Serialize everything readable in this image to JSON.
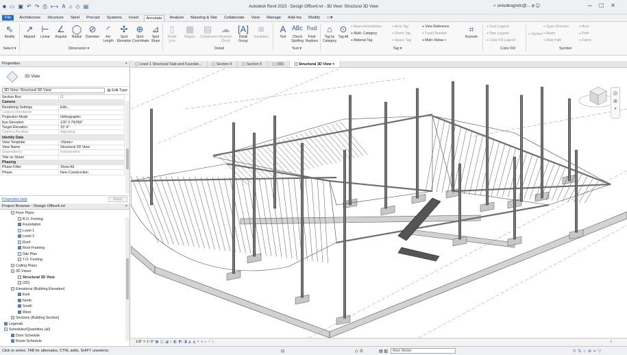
{
  "window": {
    "title": "Autodesk Revit 2023 - Design Office4.rvt - 3D View: Structural 3D View",
    "user": "unisdesgndc@..."
  },
  "ribbon_tabs": [
    "File",
    "Architecture",
    "Structure",
    "Steel",
    "Precast",
    "Systems",
    "Insert",
    "Annotate",
    "Analyze",
    "Massing & Site",
    "Collaborate",
    "View",
    "Manage",
    "Add-Ins",
    "Modify"
  ],
  "ribbon": {
    "modify": "Modify",
    "select": "Select ▾",
    "dimension_group": "Dimension ▾",
    "detail_group": "Detail",
    "text_group": "Text ▾",
    "tag_group": "Tag ▾",
    "color_fill_group": "Color Fill",
    "symbol_group": "Symbol",
    "dim_tools": [
      "Aligned",
      "Linear",
      "Angular",
      "Radial",
      "Diameter",
      "Arc Length",
      "Spot Elevation",
      "Spot Coordinate",
      "Spot Slope"
    ],
    "detail_tools": [
      "Detail Line",
      "Region",
      "Component",
      "Revision Cloud",
      "Detail Group",
      "Insulation"
    ],
    "text_tools": [
      "Text",
      "Check Spelling",
      "Find/ Replace"
    ],
    "tag_tools": [
      "Tag by Category",
      "Tag All"
    ],
    "tag_small": [
      "Beam Annotations",
      "Multi- Category",
      "Material Tag",
      "Area Tag",
      "Room Tag",
      "Space Tag",
      "View Reference",
      "Tread Number",
      "Multi- Rebar ▾"
    ],
    "keynote": "Keynote",
    "fill_small": [
      "Duct Legend",
      "Pipe Legend",
      "Color Fill Legend"
    ],
    "symbol_small": [
      "Symbol",
      "Span Direction",
      "Beam",
      "Stair Path",
      "Area",
      "Path",
      "Fabric"
    ]
  },
  "properties": {
    "header": "Properties",
    "type_name": "3D View",
    "selector": "3D View: Structural 3D View",
    "edit_type": "Edit Type",
    "rows": [
      {
        "k": "Section Box",
        "v": "☐",
        "cat": false,
        "dim": false
      },
      {
        "k": "Camera",
        "v": "",
        "cat": true,
        "dim": false
      },
      {
        "k": "Rendering Settings",
        "v": "Edit...",
        "cat": false,
        "dim": false
      },
      {
        "k": "Locked Orientation",
        "v": "",
        "cat": false,
        "dim": true
      },
      {
        "k": "Projection Mode",
        "v": "Orthographic",
        "cat": false,
        "dim": false
      },
      {
        "k": "Eye Elevation",
        "v": "130' 3 79/256\"",
        "cat": false,
        "dim": false
      },
      {
        "k": "Target Elevation",
        "v": "15' 4\"",
        "cat": false,
        "dim": false
      },
      {
        "k": "Camera Position",
        "v": "Adjusting",
        "cat": false,
        "dim": true
      },
      {
        "k": "Identity Data",
        "v": "",
        "cat": true,
        "dim": false
      },
      {
        "k": "View Template",
        "v": "<None>",
        "cat": false,
        "dim": false
      },
      {
        "k": "View Name",
        "v": "Structural 3D View",
        "cat": false,
        "dim": false
      },
      {
        "k": "Dependency",
        "v": "Independent",
        "cat": false,
        "dim": true
      },
      {
        "k": "Title on Sheet",
        "v": "",
        "cat": false,
        "dim": false
      },
      {
        "k": "Phasing",
        "v": "",
        "cat": true,
        "dim": false
      },
      {
        "k": "Phase Filter",
        "v": "Show All",
        "cat": false,
        "dim": false
      },
      {
        "k": "Phase",
        "v": "New Construction",
        "cat": false,
        "dim": false
      }
    ],
    "help": "Properties help",
    "apply": "Apply"
  },
  "browser": {
    "header": "Project Browser - Design Office4.rvt",
    "items": [
      {
        "label": "Floor Plans",
        "lvl": 1,
        "t": "ex"
      },
      {
        "label": "B.O. Footing",
        "lvl": 2,
        "t": "vi"
      },
      {
        "label": "Foundation",
        "lvl": 2,
        "t": "vb"
      },
      {
        "label": "Level 1",
        "lvl": 2,
        "t": "vi"
      },
      {
        "label": "Level 2",
        "lvl": 2,
        "t": "vb"
      },
      {
        "label": "Roof",
        "lvl": 2,
        "t": "vi"
      },
      {
        "label": "Roof Framing",
        "lvl": 2,
        "t": "vb"
      },
      {
        "label": "Site Plan",
        "lvl": 2,
        "t": "vi"
      },
      {
        "label": "T.O. Footing",
        "lvl": 2,
        "t": "vi"
      },
      {
        "label": "Ceiling Plans",
        "lvl": 1,
        "t": "ex"
      },
      {
        "label": "3D Views",
        "lvl": 1,
        "t": "ex"
      },
      {
        "label": "Structural 3D View",
        "lvl": 2,
        "t": "vi",
        "sel": true
      },
      {
        "label": "{3D}",
        "lvl": 2,
        "t": "vi"
      },
      {
        "label": "Elevations (Building Elevation)",
        "lvl": 1,
        "t": "ex"
      },
      {
        "label": "East",
        "lvl": 2,
        "t": "vb"
      },
      {
        "label": "North",
        "lvl": 2,
        "t": "vb"
      },
      {
        "label": "South",
        "lvl": 2,
        "t": "vb"
      },
      {
        "label": "West",
        "lvl": 2,
        "t": "vb"
      },
      {
        "label": "Sections (Building Section)",
        "lvl": 1,
        "t": "ex"
      },
      {
        "label": "Legends",
        "lvl": 0,
        "t": "vb"
      },
      {
        "label": "Schedules/Quantities (all)",
        "lvl": 0,
        "t": "ex"
      },
      {
        "label": "Door Schedule",
        "lvl": 1,
        "t": "vb"
      },
      {
        "label": "Room Schedule",
        "lvl": 1,
        "t": "vb"
      }
    ]
  },
  "view_tabs": [
    "Level 1 Structural Slab and Foundat...",
    "Section 4",
    "Section 5",
    "{3D}",
    "Structural 3D View"
  ],
  "viewbar": {
    "scale": "1/8\" = 1'-0\""
  },
  "status": {
    "text": "Click to select, TAB for alternates, CTRL adds, SHIFT unselects.",
    "model": "Main Model",
    "zero": ":0"
  },
  "colors": {
    "accent": "#2c6bbf",
    "concrete": "#c8c8c8",
    "steel": "#3c3c3c"
  }
}
